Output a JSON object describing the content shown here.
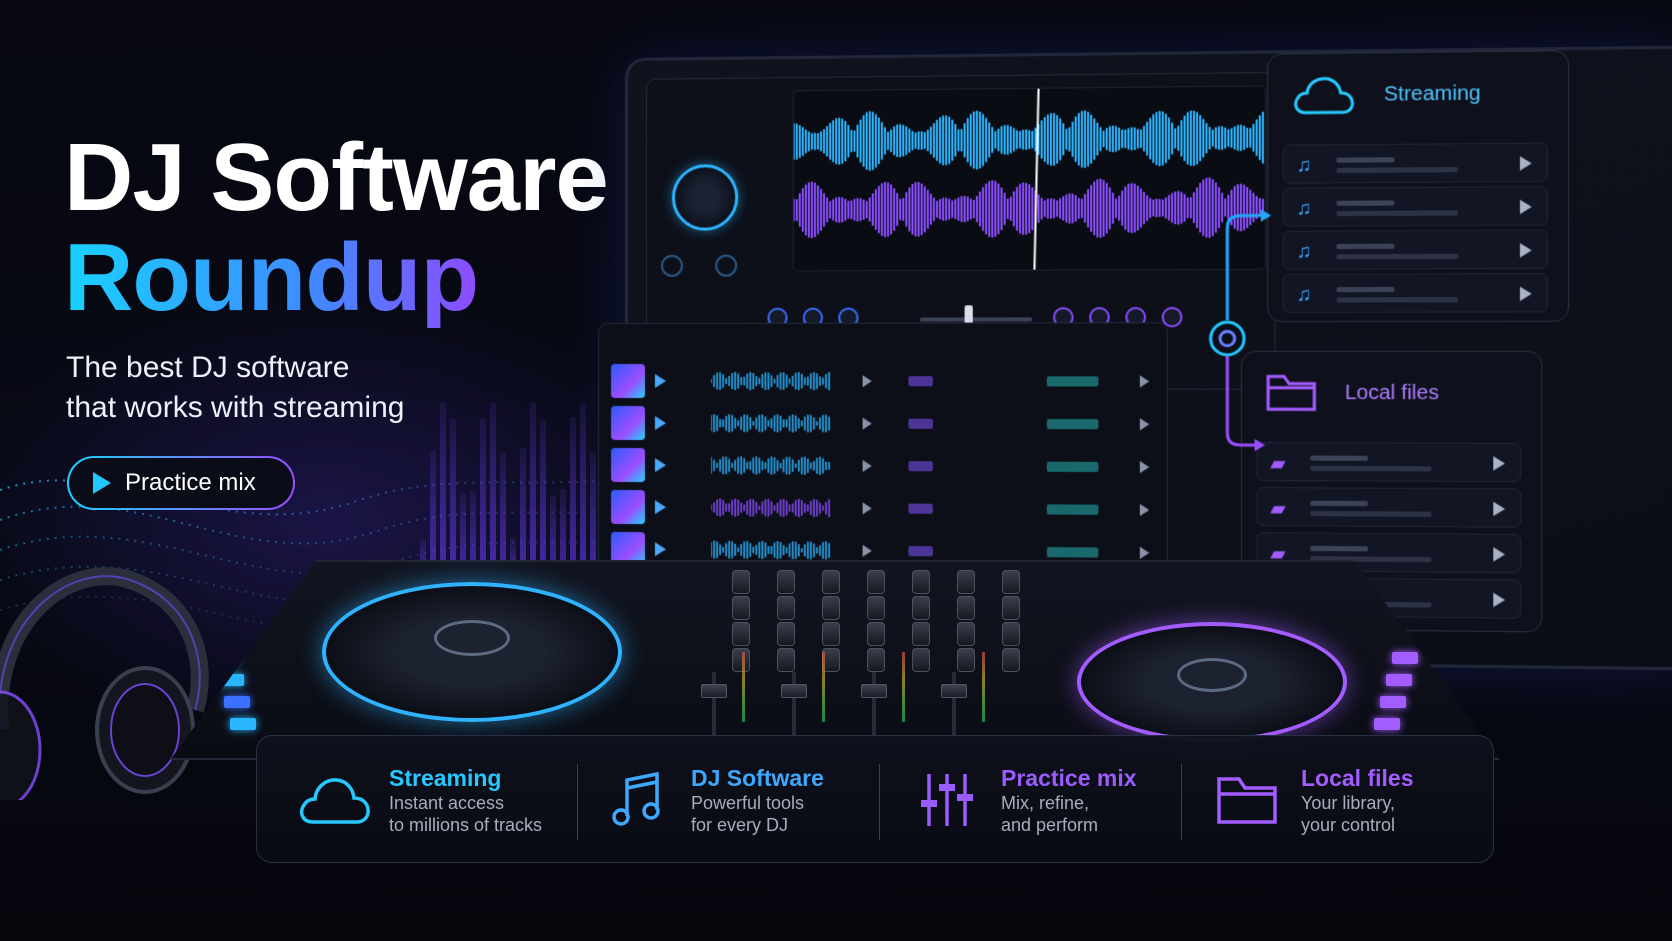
{
  "hero": {
    "title_line1": "DJ Software",
    "title_line2": "Roundup",
    "subtitle_line1": "The best DJ software",
    "subtitle_line2": "that works with streaming",
    "cta_label": "Practice mix"
  },
  "screen": {
    "streaming_label": "Streaming",
    "local_files_label": "Local files",
    "library_row_count": 5
  },
  "features": [
    {
      "title": "Streaming",
      "desc_line1": "Instant access",
      "desc_line2": "to millions of tracks",
      "icon": "cloud-icon",
      "color": "#27c8ff"
    },
    {
      "title": "DJ Software",
      "desc_line1": "Powerful tools",
      "desc_line2": "for every DJ",
      "icon": "music-note-icon",
      "color": "#3ea8ff"
    },
    {
      "title": "Practice mix",
      "desc_line1": "Mix, refine,",
      "desc_line2": "and perform",
      "icon": "sliders-icon",
      "color": "#9a5cff"
    },
    {
      "title": "Local files",
      "desc_line1": "Your library,",
      "desc_line2": "your control",
      "icon": "folder-icon",
      "color": "#a35cff"
    }
  ],
  "colors": {
    "cyan": "#1ad2ff",
    "blue": "#3e8bff",
    "purple": "#9a4dff",
    "background": "#05060d"
  }
}
